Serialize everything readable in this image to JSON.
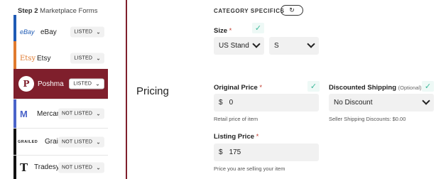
{
  "sidebar": {
    "step_number": "Step 2",
    "step_text": "Marketplace Forms",
    "items": [
      {
        "logo": "eBay",
        "name": "eBay",
        "status": "LISTED",
        "accent": "#1f5bb5"
      },
      {
        "logo": "Etsy",
        "name": "Etsy",
        "status": "LISTED",
        "accent": "#e07a2e"
      },
      {
        "logo": "P",
        "name": "Poshma",
        "status": "LISTED",
        "accent": "#7f1f2c"
      },
      {
        "logo": "M",
        "name": "Mercari",
        "status": "NOT LISTED",
        "accent": "#4a63c9"
      },
      {
        "logo": "GRAILED",
        "name": "Grailed",
        "status": "NOT LISTED",
        "accent": "#111111"
      },
      {
        "logo": "T",
        "name": "Tradesy",
        "status": "NOT LISTED",
        "accent": "#111111"
      }
    ]
  },
  "section": {
    "label": "Pricing"
  },
  "category_specifics": {
    "title": "CATEGORY SPECIFICS",
    "refresh_icon": "refresh-icon"
  },
  "size": {
    "label": "Size",
    "required_mark": "*",
    "standard_value": "US Stand",
    "size_value": "S"
  },
  "original_price": {
    "label": "Original Price",
    "required_mark": "*",
    "currency": "$",
    "value": "0",
    "hint": "Retail price of item"
  },
  "discounted_shipping": {
    "label": "Discounted Shipping",
    "optional": "(Optional)",
    "value": "No Discount",
    "hint": "Seller Shipping Discounts: $0.00"
  },
  "listing_price": {
    "label": "Listing Price",
    "required_mark": "*",
    "currency": "$",
    "value": "175",
    "hint": "Price you are selling your item"
  },
  "colors": {
    "accent": "#7f1f2c",
    "check": "#3cb89a"
  }
}
